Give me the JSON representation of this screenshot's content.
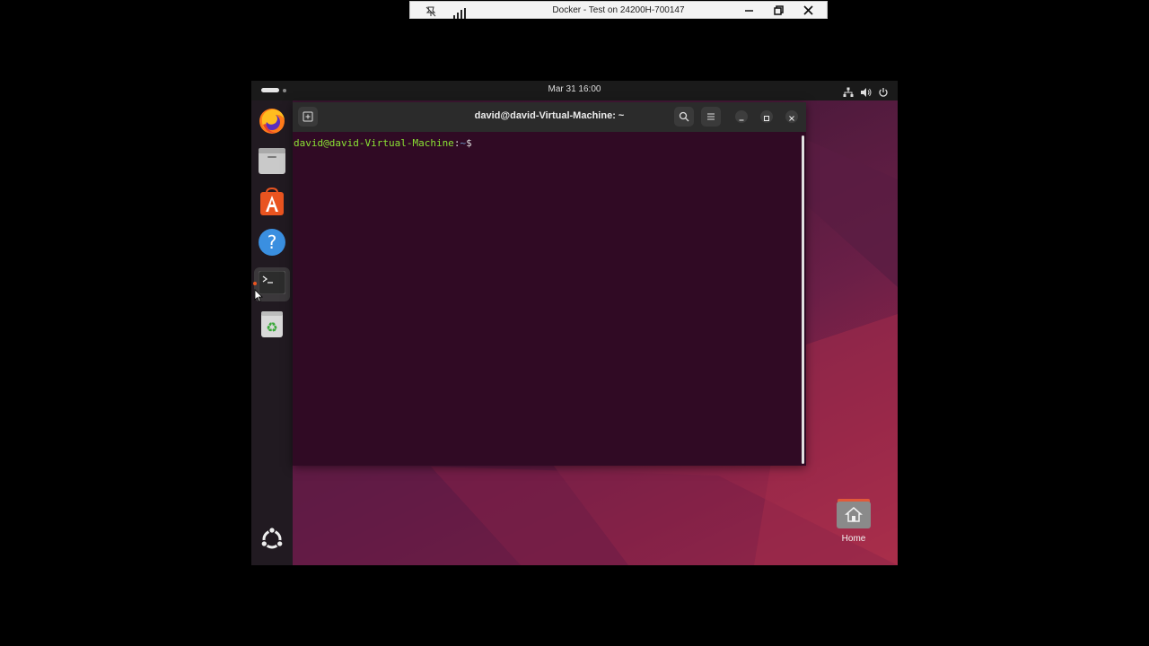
{
  "remote_viewer": {
    "title": "Docker - Test on 24200H-700147",
    "icons": [
      "pin-off-icon",
      "signal-icon",
      "minimize-icon",
      "restore-icon",
      "close-icon"
    ]
  },
  "topbar": {
    "clock": "Mar 31  16:00",
    "tray_icons": [
      "network-icon",
      "volume-icon",
      "power-icon"
    ]
  },
  "dock": {
    "items": [
      {
        "name": "firefox",
        "icon": "firefox-icon"
      },
      {
        "name": "files",
        "icon": "files-icon"
      },
      {
        "name": "app-center",
        "icon": "app-center-icon"
      },
      {
        "name": "help",
        "icon": "help-icon"
      },
      {
        "name": "terminal",
        "icon": "terminal-icon",
        "active": true
      },
      {
        "name": "trash",
        "icon": "trash-icon"
      }
    ],
    "show_apps_icon": "ubuntu-logo-icon"
  },
  "terminal": {
    "title": "david@david-Virtual-Machine: ~",
    "prompt_user": "david@david-Virtual-Machine",
    "prompt_colon": ":",
    "prompt_path": "~",
    "prompt_symbol": "$"
  },
  "desktop": {
    "home_label": "Home"
  },
  "colors": {
    "terminal_bg": "#300a24",
    "prompt_user": "#8ae234",
    "prompt_path": "#729fcf",
    "ubuntu_orange": "#e95420"
  }
}
